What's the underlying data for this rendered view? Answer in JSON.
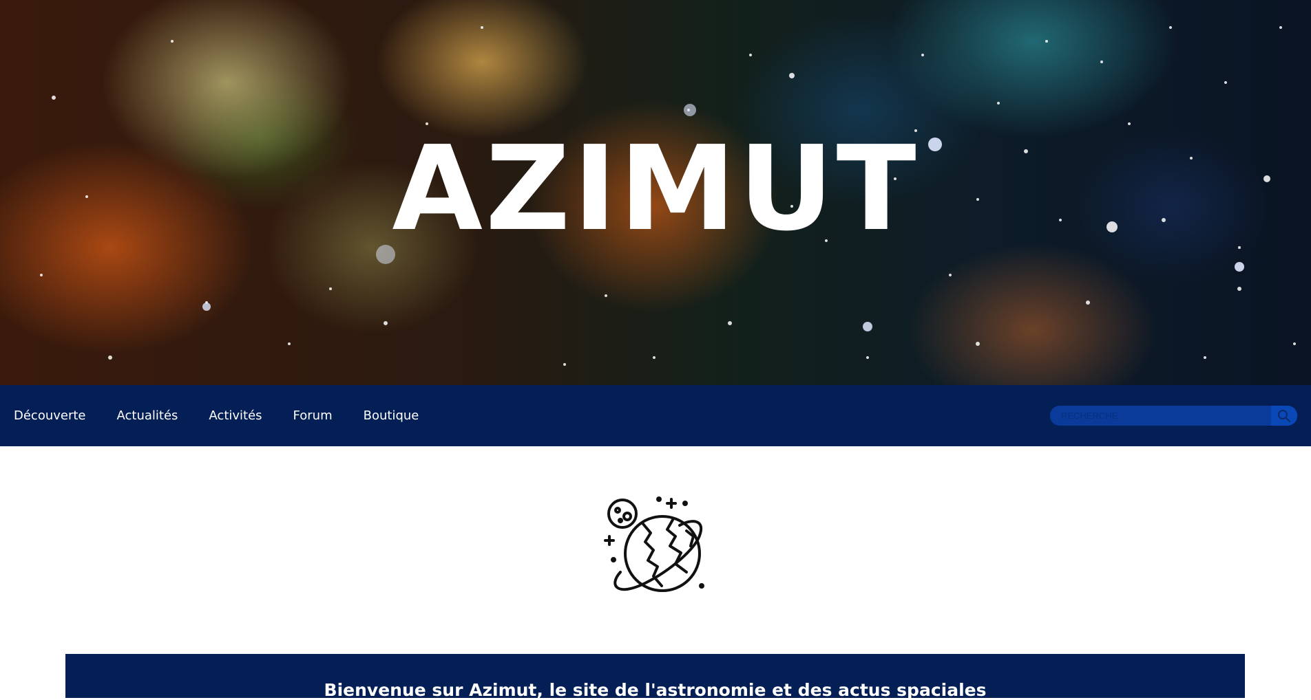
{
  "hero": {
    "title": "AZIMUT"
  },
  "nav": {
    "items": [
      {
        "label": "Découverte"
      },
      {
        "label": "Actualités"
      },
      {
        "label": "Activités"
      },
      {
        "label": "Forum"
      },
      {
        "label": "Boutique"
      }
    ]
  },
  "search": {
    "placeholder": "RECHERCHE",
    "icon": "search-icon"
  },
  "logo": {
    "icon": "planet-globe-icon"
  },
  "welcome": {
    "text": "Bienvenue sur Azimut, le site de l'astronomie et des actus spaciales"
  },
  "colors": {
    "nav_background": "#041f55",
    "search_background": "#0a3a9a",
    "text_on_dark": "#ffffff"
  }
}
